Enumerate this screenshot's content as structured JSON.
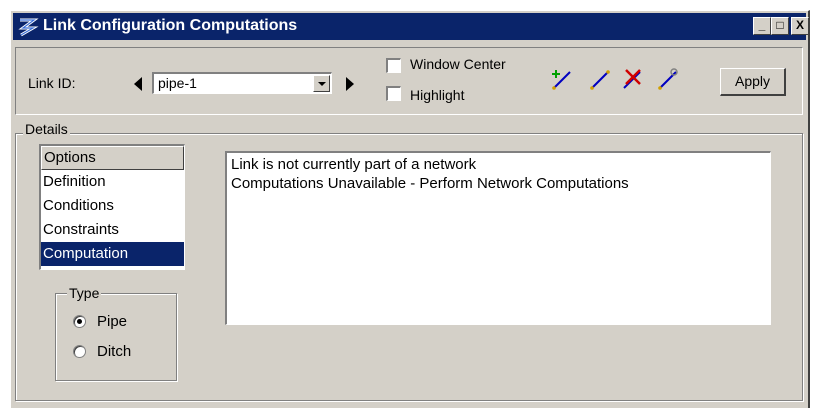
{
  "window": {
    "title": "Link Configuration Computations",
    "controls": {
      "minimize": "_",
      "maximize": "□",
      "close": "X"
    }
  },
  "toolbar": {
    "link_id_label": "Link ID:",
    "link_id_value": "pipe-1",
    "window_center_label": "Window Center",
    "window_center_checked": false,
    "highlight_label": "Highlight",
    "highlight_checked": false,
    "icons": [
      "add-link-icon",
      "select-link-icon",
      "delete-link-icon",
      "edit-link-icon"
    ],
    "apply_label": "Apply"
  },
  "details": {
    "group_label": "Details",
    "options_header": "Options",
    "options": [
      {
        "label": "Definition",
        "selected": false
      },
      {
        "label": "Conditions",
        "selected": false
      },
      {
        "label": "Constraints",
        "selected": false
      },
      {
        "label": "Computation",
        "selected": true
      }
    ],
    "type_group_label": "Type",
    "type_options": [
      {
        "label": "Pipe",
        "selected": true
      },
      {
        "label": "Ditch",
        "selected": false
      }
    ],
    "messages": [
      "Link is not currently part of a network",
      "Computations Unavailable - Perform Network Computations"
    ]
  },
  "colors": {
    "titlebar": "#0a246a",
    "face": "#d4d0c8",
    "selection": "#0a246a"
  }
}
